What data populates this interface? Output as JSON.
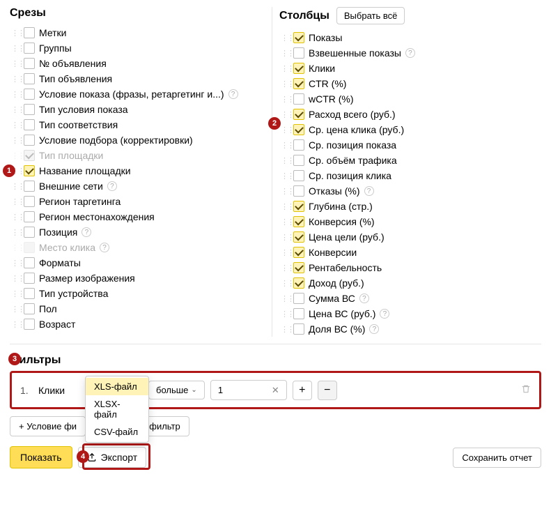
{
  "annotations": {
    "a1": "1",
    "a2": "2",
    "a3": "3",
    "a4": "4"
  },
  "slices": {
    "title": "Срезы",
    "items": [
      {
        "label": "Метки",
        "checked": false,
        "disabled": false,
        "help": false
      },
      {
        "label": "Группы",
        "checked": false,
        "disabled": false,
        "help": false
      },
      {
        "label": "№ объявления",
        "checked": false,
        "disabled": false,
        "help": false
      },
      {
        "label": "Тип объявления",
        "checked": false,
        "disabled": false,
        "help": false
      },
      {
        "label": "Условие показа (фразы, ретаргетинг и...)",
        "checked": false,
        "disabled": false,
        "help": true
      },
      {
        "label": "Тип условия показа",
        "checked": false,
        "disabled": false,
        "help": false
      },
      {
        "label": "Тип соответствия",
        "checked": false,
        "disabled": false,
        "help": false
      },
      {
        "label": "Условие подбора (корректировки)",
        "checked": false,
        "disabled": false,
        "help": false
      },
      {
        "label": "Тип площадки",
        "checked": false,
        "disabled": true,
        "locked": true,
        "help": false
      },
      {
        "label": "Название площадки",
        "checked": true,
        "disabled": false,
        "help": false,
        "annot": "a1"
      },
      {
        "label": "Внешние сети",
        "checked": false,
        "disabled": false,
        "help": true
      },
      {
        "label": "Регион таргетинга",
        "checked": false,
        "disabled": false,
        "help": false
      },
      {
        "label": "Регион местонахождения",
        "checked": false,
        "disabled": false,
        "help": false
      },
      {
        "label": "Позиция",
        "checked": false,
        "disabled": false,
        "help": true
      },
      {
        "label": "Место клика",
        "checked": false,
        "disabled": true,
        "locked": false,
        "help": true
      },
      {
        "label": "Форматы",
        "checked": false,
        "disabled": false,
        "help": false
      },
      {
        "label": "Размер изображения",
        "checked": false,
        "disabled": false,
        "help": false
      },
      {
        "label": "Тип устройства",
        "checked": false,
        "disabled": false,
        "help": false
      },
      {
        "label": "Пол",
        "checked": false,
        "disabled": false,
        "help": false
      },
      {
        "label": "Возраст",
        "checked": false,
        "disabled": false,
        "help": false
      }
    ]
  },
  "columns": {
    "title": "Столбцы",
    "select_all": "Выбрать всё",
    "annot": "a2",
    "items": [
      {
        "label": "Показы",
        "checked": true,
        "help": false
      },
      {
        "label": "Взвешенные показы",
        "checked": false,
        "help": true
      },
      {
        "label": "Клики",
        "checked": true,
        "help": false
      },
      {
        "label": "CTR (%)",
        "checked": true,
        "help": false
      },
      {
        "label": "wCTR (%)",
        "checked": false,
        "help": false
      },
      {
        "label": "Расход всего (руб.)",
        "checked": true,
        "help": false
      },
      {
        "label": "Ср. цена клика (руб.)",
        "checked": true,
        "help": false
      },
      {
        "label": "Ср. позиция показа",
        "checked": false,
        "help": false
      },
      {
        "label": "Ср. объём трафика",
        "checked": false,
        "help": false
      },
      {
        "label": "Ср. позиция клика",
        "checked": false,
        "help": false
      },
      {
        "label": "Отказы (%)",
        "checked": false,
        "help": true
      },
      {
        "label": "Глубина (стр.)",
        "checked": true,
        "help": false
      },
      {
        "label": "Конверсия (%)",
        "checked": true,
        "help": false
      },
      {
        "label": "Цена цели (руб.)",
        "checked": true,
        "help": false
      },
      {
        "label": "Конверсии",
        "checked": true,
        "help": false
      },
      {
        "label": "Рентабельность",
        "checked": true,
        "help": false
      },
      {
        "label": "Доход (руб.)",
        "checked": true,
        "help": false
      },
      {
        "label": "Сумма ВС",
        "checked": false,
        "help": true
      },
      {
        "label": "Цена ВС (руб.)",
        "checked": false,
        "help": true
      },
      {
        "label": "Доля ВС (%)",
        "checked": false,
        "help": true
      }
    ]
  },
  "filters": {
    "title": "Фильтры",
    "annot": "a3",
    "row": {
      "num": "1.",
      "field": "Клики",
      "operator": "больше",
      "value": "1"
    },
    "add_condition": "+ Условие фи",
    "save_filter": "Сохранить фильтр"
  },
  "export_menu": {
    "items": [
      {
        "label": "XLS-файл",
        "active": true
      },
      {
        "label": "XLSX-файл",
        "active": false
      },
      {
        "label": "CSV-файл",
        "active": false
      }
    ]
  },
  "footer": {
    "show": "Показать",
    "export": "Экспорт",
    "export_annot": "a4",
    "save_report": "Сохранить отчет"
  }
}
